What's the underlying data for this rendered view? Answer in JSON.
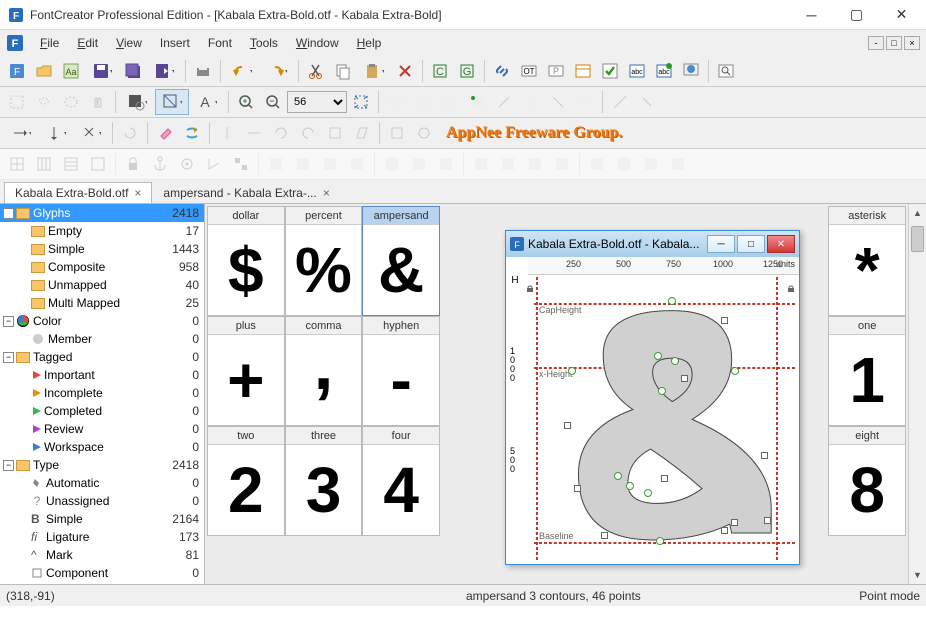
{
  "window": {
    "title": "FontCreator Professional Edition  -  [Kabala Extra-Bold.otf - Kabala Extra-Bold]"
  },
  "menu": {
    "file": "File",
    "edit": "Edit",
    "view": "View",
    "insert": "Insert",
    "font": "Font",
    "tools": "Tools",
    "window": "Window",
    "help": "Help"
  },
  "zoom_value": "56",
  "watermark": "AppNee Freeware Group.",
  "tabs": {
    "main": "Kabala Extra-Bold.otf",
    "glyph": "ampersand - Kabala Extra-..."
  },
  "tree": {
    "glyphs": {
      "label": "Glyphs",
      "count": "2418"
    },
    "empty": {
      "label": "Empty",
      "count": "17"
    },
    "simple": {
      "label": "Simple",
      "count": "1443"
    },
    "composite": {
      "label": "Composite",
      "count": "958"
    },
    "unmapped": {
      "label": "Unmapped",
      "count": "40"
    },
    "multimapped": {
      "label": "Multi Mapped",
      "count": "25"
    },
    "color": {
      "label": "Color",
      "count": "0"
    },
    "member": {
      "label": "Member",
      "count": "0"
    },
    "tagged": {
      "label": "Tagged",
      "count": "0"
    },
    "important": {
      "label": "Important",
      "count": "0"
    },
    "incomplete": {
      "label": "Incomplete",
      "count": "0"
    },
    "completed": {
      "label": "Completed",
      "count": "0"
    },
    "review": {
      "label": "Review",
      "count": "0"
    },
    "workspace": {
      "label": "Workspace",
      "count": "0"
    },
    "type": {
      "label": "Type",
      "count": "2418"
    },
    "automatic": {
      "label": "Automatic",
      "count": "0"
    },
    "unassigned": {
      "label": "Unassigned",
      "count": "0"
    },
    "simple2": {
      "label": "Simple",
      "count": "2164"
    },
    "ligature": {
      "label": "Ligature",
      "count": "173"
    },
    "mark": {
      "label": "Mark",
      "count": "81"
    },
    "component": {
      "label": "Component",
      "count": "0"
    }
  },
  "glyph_cells": {
    "r1": [
      {
        "name": "dollar",
        "char": "$"
      },
      {
        "name": "percent",
        "char": "%"
      },
      {
        "name": "ampersand",
        "char": "&"
      },
      {
        "name": "",
        "char": ""
      },
      {
        "name": "",
        "char": ""
      },
      {
        "name": "",
        "char": ""
      },
      {
        "name": "",
        "char": ""
      },
      {
        "name": "",
        "char": ""
      },
      {
        "name": "asterisk",
        "char": "*"
      }
    ],
    "r2": [
      {
        "name": "plus",
        "char": "+"
      },
      {
        "name": "comma",
        "char": ","
      },
      {
        "name": "hyphen",
        "char": "-"
      },
      {
        "name": "",
        "char": ""
      },
      {
        "name": "",
        "char": ""
      },
      {
        "name": "",
        "char": ""
      },
      {
        "name": "",
        "char": ""
      },
      {
        "name": "",
        "char": ""
      },
      {
        "name": "one",
        "char": "1"
      }
    ],
    "r3": [
      {
        "name": "two",
        "char": "2"
      },
      {
        "name": "three",
        "char": "3"
      },
      {
        "name": "four",
        "char": "4"
      },
      {
        "name": "",
        "char": ""
      },
      {
        "name": "",
        "char": ""
      },
      {
        "name": "",
        "char": ""
      },
      {
        "name": "",
        "char": ""
      },
      {
        "name": "",
        "char": ""
      },
      {
        "name": "eight",
        "char": "8"
      }
    ]
  },
  "editor": {
    "title": "Kabala Extra-Bold.otf - Kabala...",
    "ruler": {
      "t250": "250",
      "t500": "500",
      "t750": "750",
      "t1000": "1000",
      "t1250": "1250",
      "units": "units"
    },
    "metrics": {
      "capheight": "CapHeight",
      "xheight": "x-Height",
      "baseline": "Baseline"
    },
    "ruler_v": {
      "v1000a": "1",
      "v1000b": "0",
      "v1000c": "0",
      "v1000d": "0",
      "v500a": "5",
      "v500b": "0",
      "v500c": "0"
    },
    "font_id": "H"
  },
  "status": {
    "coords": "(318,-91)",
    "glyph_info": "ampersand   3 contours, 46 points",
    "mode": "Point mode"
  }
}
